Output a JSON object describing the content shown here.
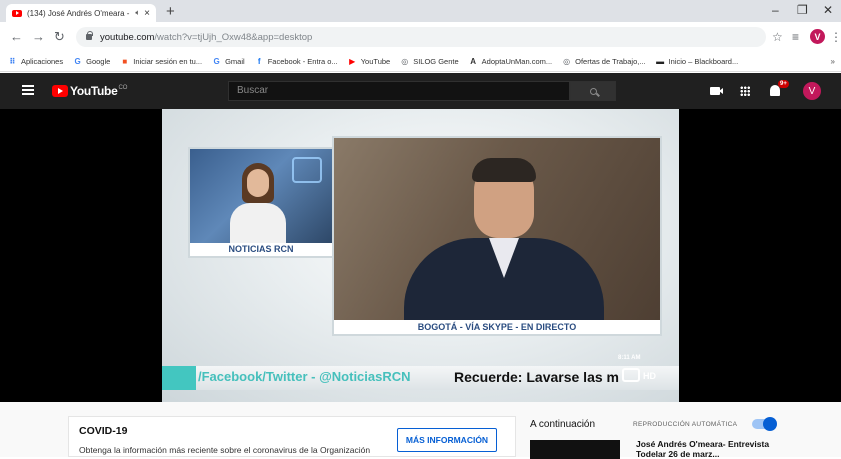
{
  "browser": {
    "tab_title": "(134) José Andrés O'meara -",
    "tab_audio_icon": "speaker-icon",
    "tab_close": "×",
    "new_tab": "+",
    "window_controls": [
      "–",
      "❐",
      "✕"
    ],
    "url_host": "youtube.com",
    "url_path": "/watch?v=tjUjh_Oxw48&app=desktop",
    "bookmarks": [
      {
        "label": "Aplicaciones",
        "icon": "apps-icon",
        "color": "#4285f4"
      },
      {
        "label": "Google",
        "icon": "google-icon",
        "color": "#4285f4"
      },
      {
        "label": "Iniciar sesión en tu...",
        "icon": "microsoft-icon",
        "color": "#f25022"
      },
      {
        "label": "Gmail",
        "icon": "google-icon",
        "color": "#4285f4"
      },
      {
        "label": "Facebook - Entra o...",
        "icon": "facebook-icon",
        "color": "#1877f2"
      },
      {
        "label": "YouTube",
        "icon": "youtube-icon",
        "color": "#ff0000"
      },
      {
        "label": "SILOG Gente",
        "icon": "globe-icon",
        "color": "#5f6368"
      },
      {
        "label": "AdoptaUnMan.com...",
        "icon": "adopta-icon",
        "color": "#333333"
      },
      {
        "label": "Ofertas de Trabajo,...",
        "icon": "globe-icon",
        "color": "#5f6368"
      },
      {
        "label": "Inicio – Blackboard...",
        "icon": "blackboard-icon",
        "color": "#222222"
      }
    ],
    "profile_initial": "V"
  },
  "youtube": {
    "logo_text": "YouTube",
    "logo_suffix": "CO",
    "search_placeholder": "Buscar",
    "notifications_badge": "9+",
    "avatar_initial": "V"
  },
  "video": {
    "anchor_caption": "NOTICIAS RCN",
    "guest_caption": "BOGOTÁ - VÍA SKYPE - EN DIRECTO",
    "clock": "8:11 AM",
    "ticker_social": "/Facebook/Twitter - @NoticiasRCN",
    "ticker_message": "Recuerde:  Lavarse las m",
    "hd_mark": "HD"
  },
  "info_panel": {
    "title": "COVID-19",
    "text": "Obtenga la información más reciente sobre el coronavirus de la Organización",
    "button": "MÁS INFORMACIÓN"
  },
  "sidebar": {
    "up_next": "A continuación",
    "autoplay": "REPRODUCCIÓN AUTOMÁTICA",
    "autoplay_on": true,
    "next_title": "José Andrés O'meara- Entrevista Todelar 26 de marz..."
  },
  "colors": {
    "youtube_red": "#ff0000",
    "header_bg": "#202020",
    "link_blue": "#065fd4",
    "rcn_teal": "#43c6c0"
  }
}
